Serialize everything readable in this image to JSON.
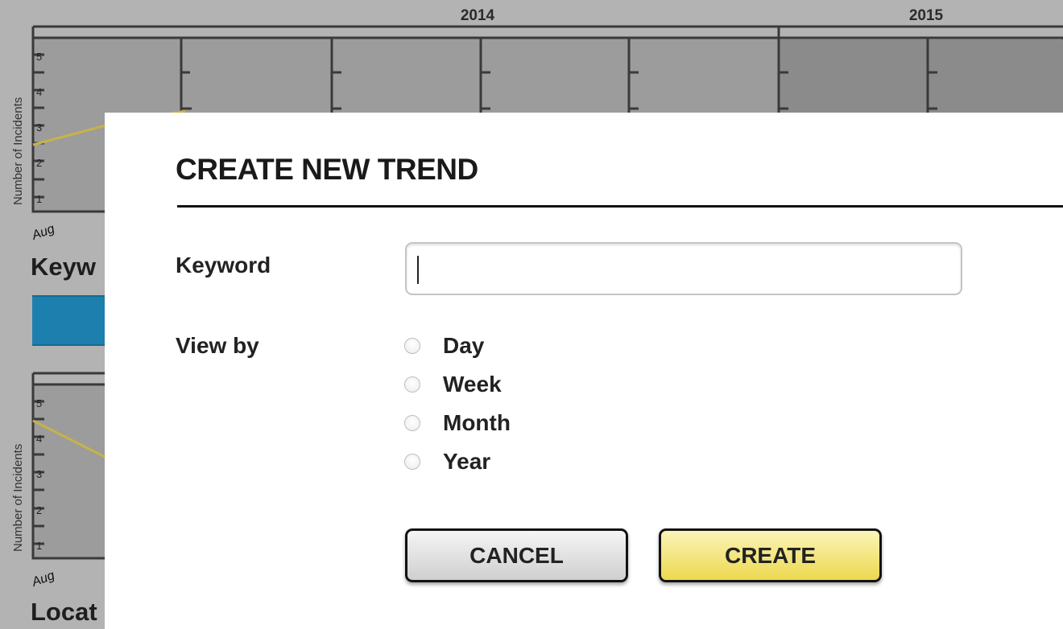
{
  "background": {
    "years": [
      "2014",
      "2015"
    ],
    "y_axis_label": "Number of Incidents",
    "y_ticks": [
      "1",
      "2",
      "3",
      "4",
      "5"
    ],
    "x_start_label": "Aug",
    "sections": [
      "Keyw",
      "Locat"
    ]
  },
  "modal": {
    "title": "CREATE NEW TREND",
    "keyword_label": "Keyword",
    "keyword_value": "",
    "view_by_label": "View by",
    "view_by_options": [
      "Day",
      "Week",
      "Month",
      "Year"
    ],
    "cancel_label": "CANCEL",
    "create_label": "CREATE"
  },
  "colors": {
    "backdrop": "#b3b3b3",
    "chart_fill": "#9c9c9c",
    "chart_fill_2015": "#8b8b8b",
    "axis": "#3a3a3a",
    "trend_line": "#c8b24a",
    "keyword_bar": "#1d7fad",
    "create_button": "#ecd84f",
    "cancel_button": "#d9d9d9"
  }
}
